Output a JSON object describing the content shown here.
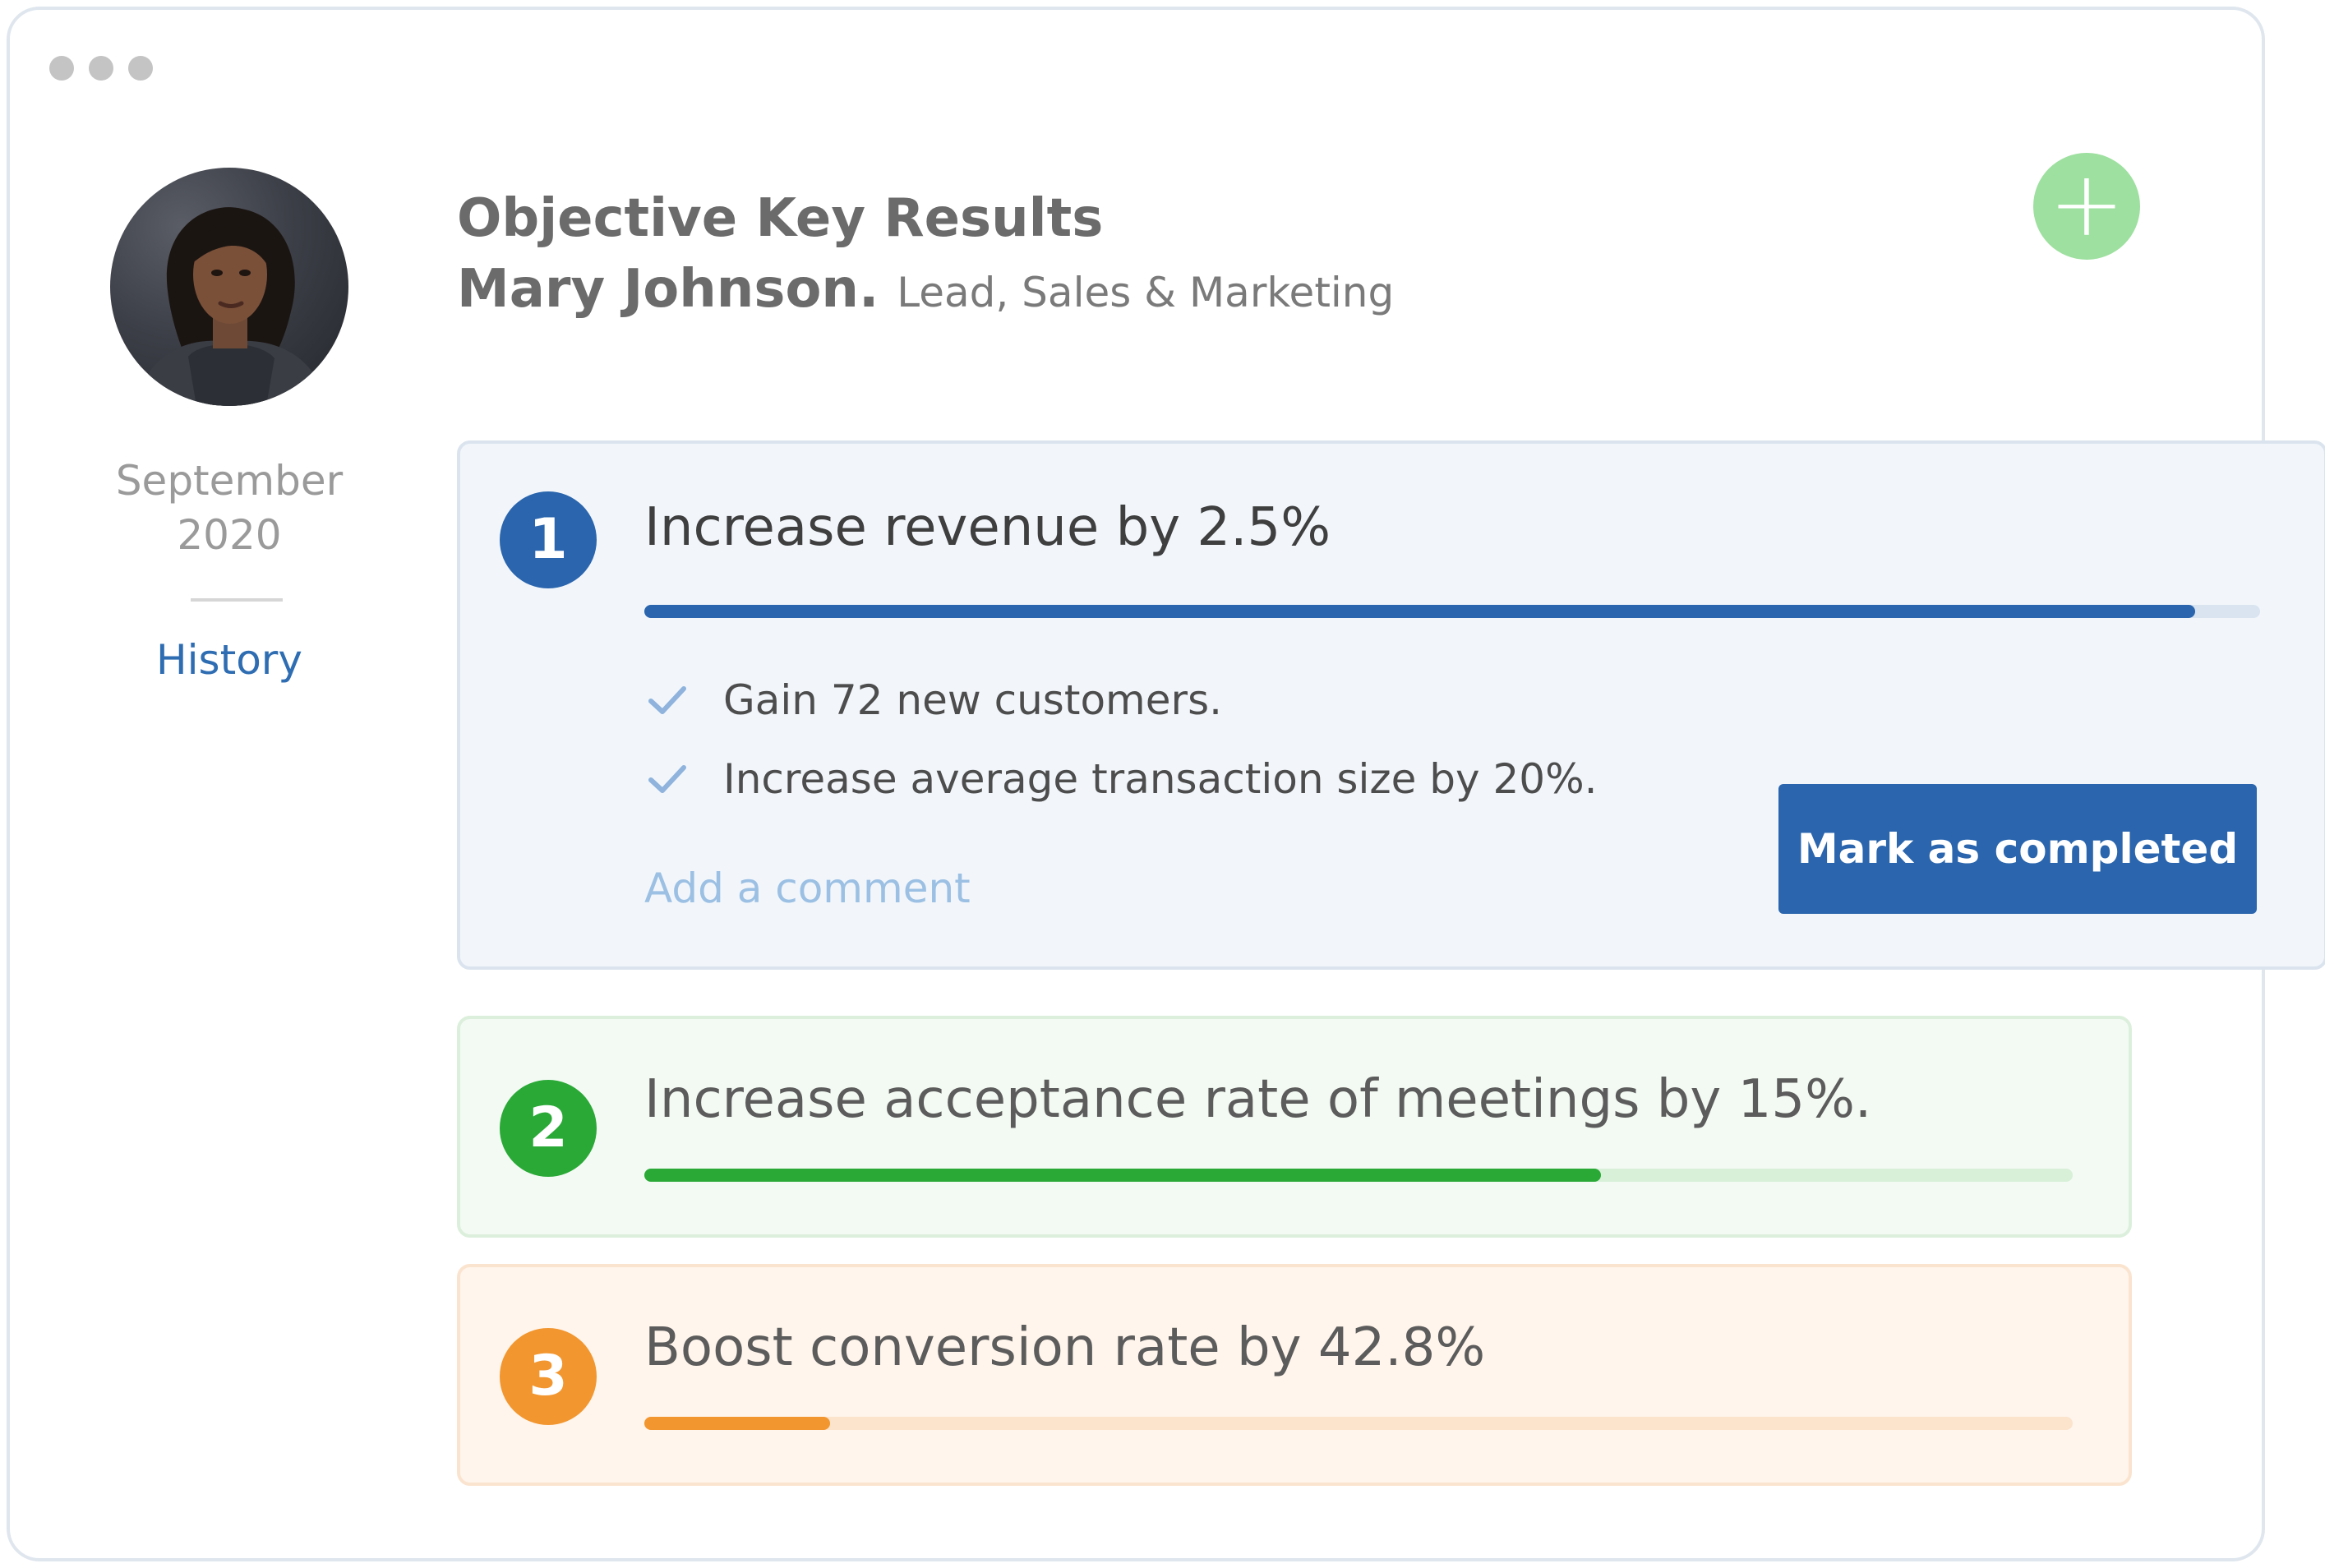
{
  "header": {
    "title": "Objective Key Results",
    "name": "Mary Johnson.",
    "role": "Lead, Sales & Marketing",
    "add_icon_glyph": "+"
  },
  "sidebar": {
    "month": "September",
    "year": "2020",
    "history_label": "History"
  },
  "objectives": [
    {
      "number": "1",
      "title": "Increase revenue by 2.5%",
      "progress": 0.96,
      "color": "#2a65ad",
      "key_results": [
        "Gain 72 new customers.",
        "Increase average transaction size by 20%."
      ],
      "comment_label": "Add a comment",
      "action_label": "Mark as completed"
    },
    {
      "number": "2",
      "title": "Increase acceptance rate of meetings by 15%.",
      "progress": 0.67,
      "color": "#2aa937"
    },
    {
      "number": "3",
      "title": "Boost conversion rate by 42.8%",
      "progress": 0.13,
      "color": "#f2962f"
    }
  ],
  "colors": {
    "accent_blue": "#2a65ad",
    "accent_green": "#2aa937",
    "accent_orange": "#f2962f",
    "add_button": "#9ee0a0",
    "check": "#8fb3dc"
  },
  "icons": {
    "window_controls": "window-dots-icon",
    "add": "plus-icon",
    "check": "check-icon"
  }
}
